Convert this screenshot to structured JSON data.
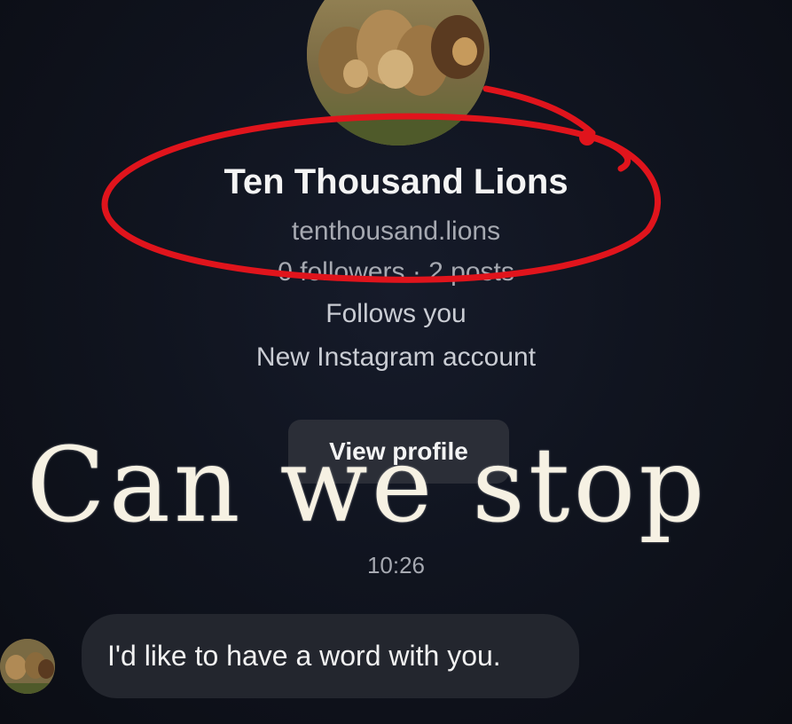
{
  "profile": {
    "name": "Ten Thousand Lions",
    "handle": "tenthousand.lions",
    "stats": "0 followers · 2 posts",
    "follows_you": "Follows you",
    "note": "New Instagram account"
  },
  "actions": {
    "view_profile_label": "View profile"
  },
  "overlay": {
    "caption": "Can we stop"
  },
  "thread": {
    "timestamp": "10:26",
    "messages": [
      {
        "text": "I'd like to have a word with you."
      }
    ]
  },
  "colors": {
    "background": "#10141f",
    "annotation": "#e0141c",
    "bubble": "#23262e",
    "button": "#2b2e37"
  }
}
